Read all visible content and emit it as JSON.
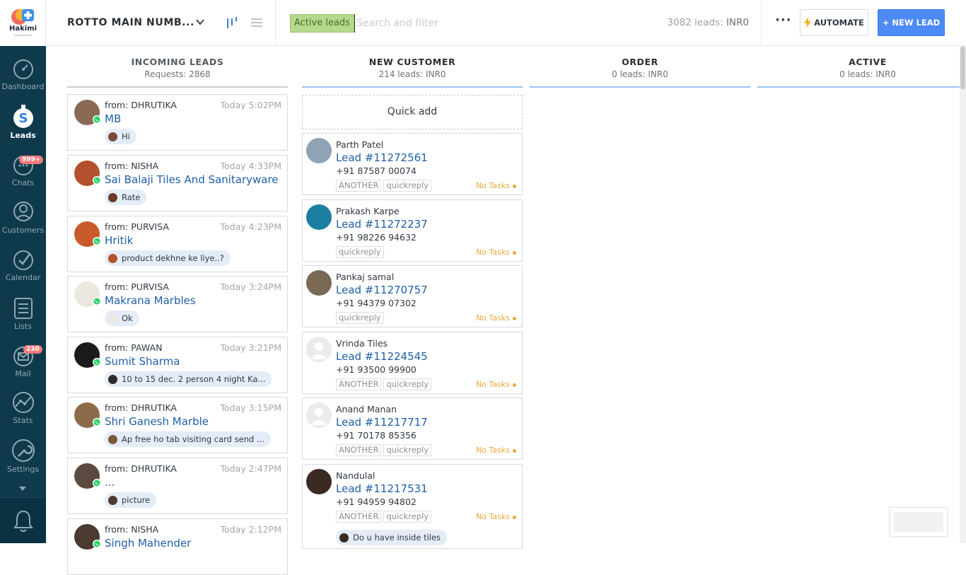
{
  "brand": {
    "name": "Hakimi",
    "sub": "WEB SOLUTIONS"
  },
  "sidebar": {
    "items": [
      {
        "label": "Dashboard",
        "icon": "dashboard-gauge-icon"
      },
      {
        "label": "Leads",
        "icon": "leads-dollar-icon",
        "active": true
      },
      {
        "label": "Chats",
        "icon": "chats-bubble-icon",
        "badge": "999+"
      },
      {
        "label": "Customers",
        "icon": "customers-person-icon"
      },
      {
        "label": "Calendar",
        "icon": "calendar-check-icon"
      },
      {
        "label": "Lists",
        "icon": "lists-icon"
      },
      {
        "label": "Mail",
        "icon": "mail-icon",
        "badge": "230"
      },
      {
        "label": "Stats",
        "icon": "stats-chart-icon"
      },
      {
        "label": "Settings",
        "icon": "settings-wrench-icon"
      }
    ],
    "notifications_icon": "bell-icon"
  },
  "topbar": {
    "pipeline": "ROTTO MAIN NUMB...",
    "filter_chip": "Active leads",
    "search_placeholder": "Search and filter",
    "lead_count": "3082 leads:",
    "lead_sum": "INR0",
    "more": "···",
    "automate": "AUTOMATE",
    "new_lead": "+ NEW LEAD"
  },
  "columns": [
    {
      "title": "INCOMING LEADS",
      "sub": "Requests: 2868",
      "color": "#c9ccd0"
    },
    {
      "title": "NEW CUSTOMER",
      "sub": "214 leads: INR0",
      "color": "#99c3f4"
    },
    {
      "title": "ORDER",
      "sub": "0 leads: INR0",
      "color": "#99c3f4"
    },
    {
      "title": "ACTIVE",
      "sub": "0 leads: INR0",
      "color": "#99c3f4"
    }
  ],
  "incoming": [
    {
      "from": "from: DHRUTIKA",
      "time": "Today 5:02PM",
      "title": "MB",
      "msg": "Hi",
      "av": "#8a6a55",
      "mini": "#7a4b3a"
    },
    {
      "from": "from: NISHA",
      "time": "Today 4:33PM",
      "title": "Sai Balaji Tiles And Sanitaryware",
      "msg": "Rate",
      "av": "#b5502e",
      "mini": "#6b3a28"
    },
    {
      "from": "from: PURVISA",
      "time": "Today 4:23PM",
      "title": "Hritik",
      "msg": "product dekhne ke liye..?",
      "av": "#c85a2a",
      "mini": "#b4532a"
    },
    {
      "from": "from: PURVISA",
      "time": "Today 3:24PM",
      "title": "Makrana Marbles",
      "msg": "Ok",
      "av": "#ece7df",
      "mini": "#ece7df"
    },
    {
      "from": "from: PAWAN",
      "time": "Today 3:21PM",
      "title": "Sumit Sharma",
      "msg": "10 to 15 dec. 2 person 4 night Ka...",
      "av": "#1b1b1b",
      "mini": "#2b2b2b"
    },
    {
      "from": "from: DHRUTIKA",
      "time": "Today 3:15PM",
      "title": "Shri Ganesh Marble",
      "msg": "Ap free ho tab visiting card send ...",
      "av": "#8d6b4a",
      "mini": "#7a5a3c"
    },
    {
      "from": "from: DHRUTIKA",
      "time": "Today 2:47PM",
      "title": "...",
      "msg": "picture",
      "av": "#5a4a40",
      "mini": "#4a3a30"
    },
    {
      "from": "from: NISHA",
      "time": "Today 2:12PM",
      "title": "Singh Mahender",
      "msg": "",
      "av": "#4a3a30",
      "mini": "#4a3a30"
    }
  ],
  "quick_add": "Quick add",
  "new_customers": [
    {
      "name": "Parth Patel",
      "lead": "Lead #11272561",
      "phone": "+91 87587 00074",
      "tags": [
        "ANOTHER",
        "quickreply"
      ],
      "status": "No Tasks",
      "av": "#8fa3b5"
    },
    {
      "name": "Prakash Karpe",
      "lead": "Lead #11272237",
      "phone": "+91 98226 94632",
      "tags": [
        "quickreply"
      ],
      "status": "No Tasks",
      "av": "#1b7fa0"
    },
    {
      "name": "Pankaj samal",
      "lead": "Lead #11270757",
      "phone": "+91 94379 07302",
      "tags": [
        "quickreply"
      ],
      "status": "No Tasks",
      "av": "#7a6a55"
    },
    {
      "name": "Vrinda Tiles",
      "lead": "Lead #11224545",
      "phone": "+91 93500 99900",
      "tags": [
        "ANOTHER",
        "quickreply"
      ],
      "status": "No Tasks",
      "av": "#e1e3e6"
    },
    {
      "name": "Anand Manan",
      "lead": "Lead #11217717",
      "phone": "+91 70178 85356",
      "tags": [
        "ANOTHER",
        "quickreply"
      ],
      "status": "No Tasks",
      "av": "#e1e3e6"
    },
    {
      "name": "Nandulal",
      "lead": "Lead #11217531",
      "phone": "+91 94959 94802",
      "tags": [
        "ANOTHER",
        "quickreply"
      ],
      "status": "No Tasks",
      "av": "#3a2a22",
      "msg": "Do u have inside tiles"
    }
  ]
}
